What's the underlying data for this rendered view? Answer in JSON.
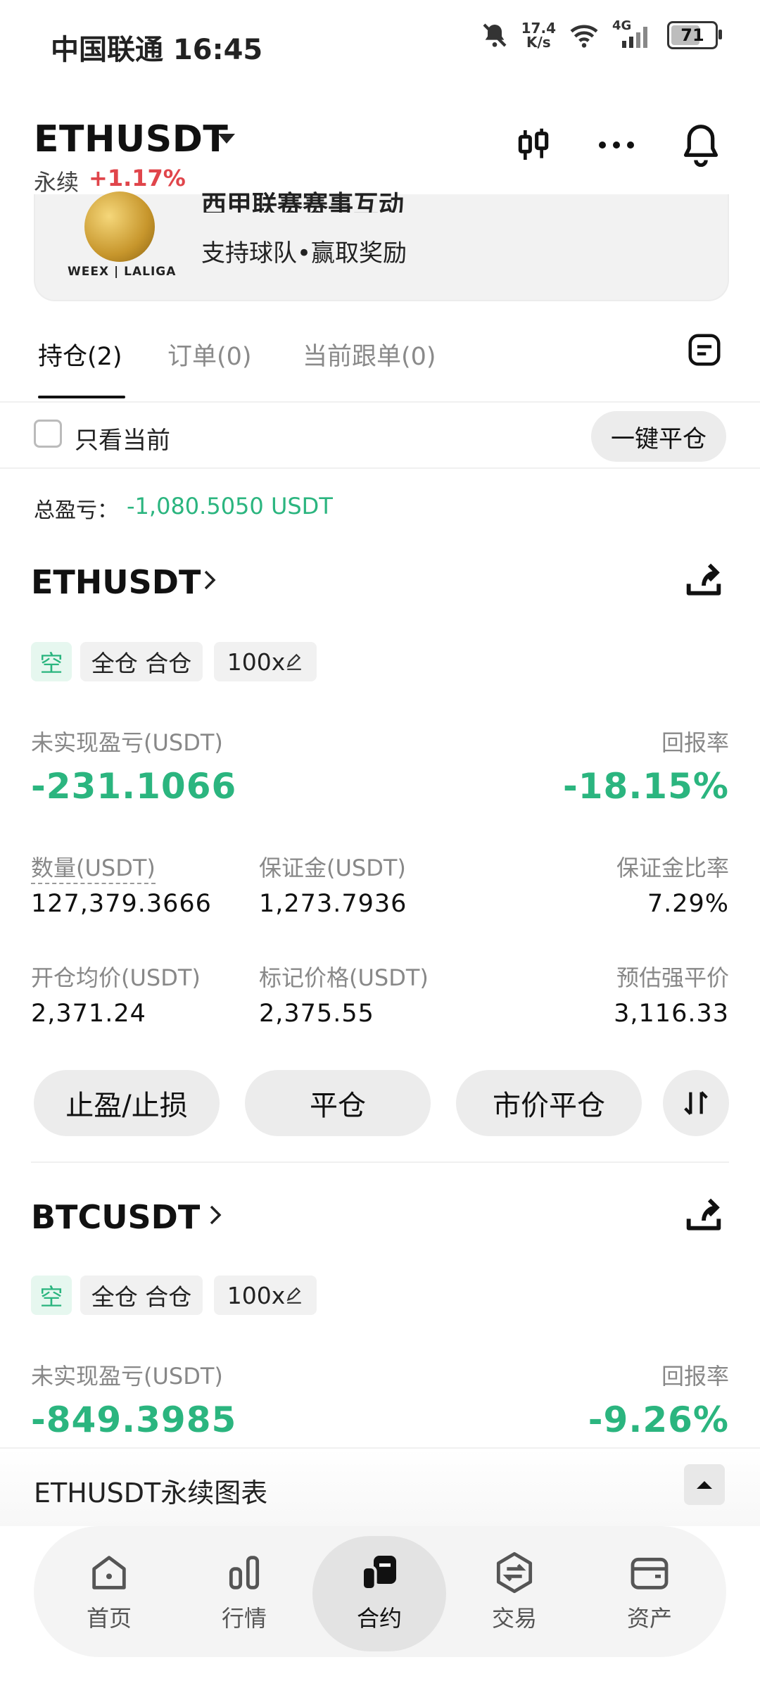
{
  "status_bar": {
    "carrier_time": "中国联通 16:45",
    "net_speed_top": "17.4",
    "net_speed_bottom": "K/s",
    "network": "4G",
    "battery": "71",
    "battery_level": 0.71
  },
  "header": {
    "symbol": "ETHUSDT",
    "type": "永续",
    "change": "+1.17%"
  },
  "banner": {
    "title": "西甲联赛赛事互动",
    "subtitle": "支持球队•赢取奖励",
    "logo_text": "WEEX | LALIGA"
  },
  "tabs": [
    "持仓(2)",
    "订单(0)",
    "当前跟单(0)"
  ],
  "filter": {
    "only_current_label": "只看当前",
    "only_current_checked": false,
    "close_all_label": "一键平仓"
  },
  "total_pnl": {
    "label": "总盈亏：",
    "value": "-1,080.5050 USDT"
  },
  "positions": [
    {
      "symbol": "ETHUSDT",
      "side": "空",
      "margin_mode": "全仓 合仓",
      "leverage": "100x",
      "unrealized_label": "未实现盈亏(USDT)",
      "unrealized_value": "-231.1066",
      "roe_label": "回报率",
      "roe_value": "-18.15%",
      "qty_label": "数量(USDT)",
      "qty_value": "127,379.3666",
      "margin_label": "保证金(USDT)",
      "margin_value": "1,273.7936",
      "margin_ratio_label": "保证金比率",
      "margin_ratio_value": "7.29%",
      "entry_label": "开仓均价(USDT)",
      "entry_value": "2,371.24",
      "mark_label": "标记价格(USDT)",
      "mark_value": "2,375.55",
      "liq_label": "预估强平价",
      "liq_value": "3,116.33"
    },
    {
      "symbol": "BTCUSDT",
      "side": "空",
      "margin_mode": "全仓 合仓",
      "leverage": "100x",
      "unrealized_label": "未实现盈亏(USDT)",
      "unrealized_value": "-849.3985",
      "roe_label": "回报率",
      "roe_value": "-9.26%"
    }
  ],
  "actions": {
    "tp_sl": "止盈/止损",
    "close": "平仓",
    "market_close": "市价平仓"
  },
  "chart_bar": {
    "title": "ETHUSDT永续图表"
  },
  "bottom_nav": [
    {
      "label": "首页",
      "icon": "home-icon"
    },
    {
      "label": "行情",
      "icon": "market-bars-icon"
    },
    {
      "label": "合约",
      "icon": "contract-icon",
      "active": true
    },
    {
      "label": "交易",
      "icon": "trade-exchange-icon"
    },
    {
      "label": "资产",
      "icon": "wallet-icon"
    }
  ],
  "colors": {
    "green": "#2bb57f",
    "red": "#e0454b",
    "pill": "#ececec"
  }
}
